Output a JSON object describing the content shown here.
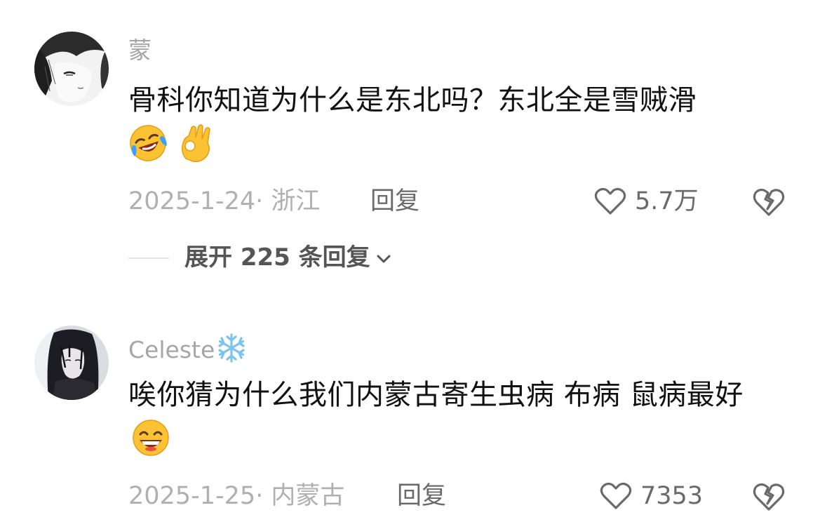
{
  "comments": [
    {
      "username": "蒙",
      "text": "骨科你知道为什么是东北吗？东北全是雪贼滑",
      "emojis": [
        "laughing-crying-emoji",
        "ok-hand-emoji"
      ],
      "date": "2025-1-24",
      "location": "浙江",
      "date_location": "2025-1-24· 浙江",
      "reply_label": "回复",
      "like_count": "5.7万",
      "replies": {
        "count": "225",
        "label": "展开 225 条回复"
      }
    },
    {
      "username": "Celeste",
      "username_icon": "snowflake-emoji",
      "text": "唉你猜为什么我们内蒙古寄生虫病 布病 鼠病最好",
      "emojis": [
        "grinning-emoji"
      ],
      "date": "2025-1-25",
      "location": "内蒙古",
      "date_location": "2025-1-25· 内蒙古",
      "reply_label": "回复",
      "like_count": "7353"
    }
  ],
  "colors": {
    "username": "#a6a6a6",
    "body_text": "#111111",
    "meta": "#b0b0b0",
    "action": "#6a6a6a",
    "divider": "#e2e2e2",
    "expand": "#555555"
  }
}
